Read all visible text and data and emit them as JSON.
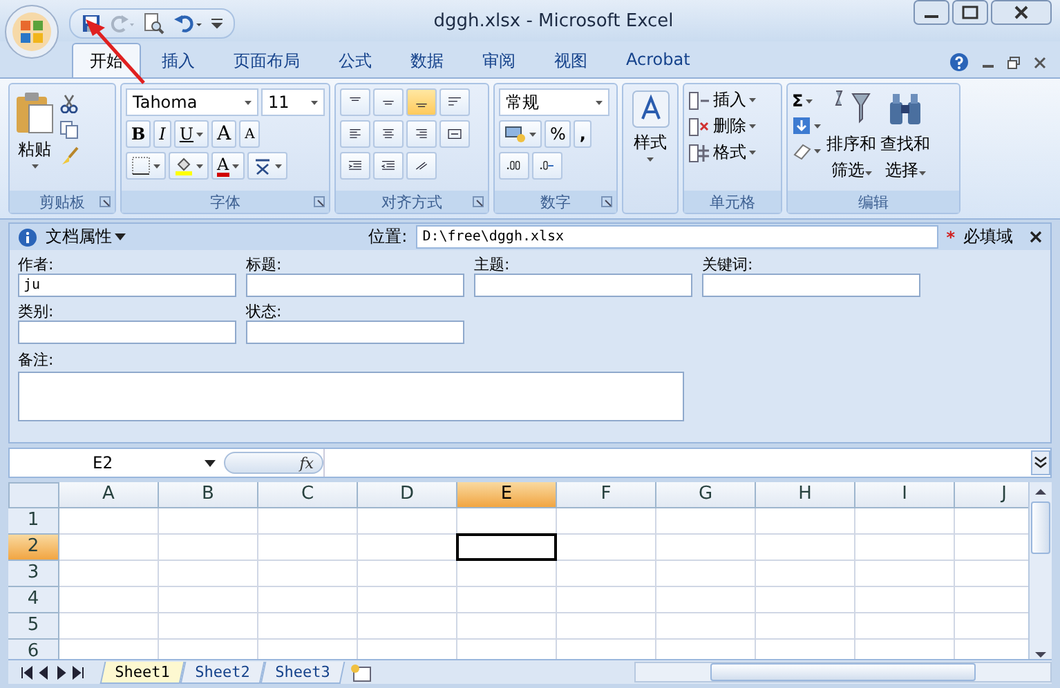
{
  "window": {
    "title": "dggh.xlsx - Microsoft Excel"
  },
  "ribbon_tabs": [
    {
      "label": "开始",
      "selected": true
    },
    {
      "label": "插入",
      "selected": false
    },
    {
      "label": "页面布局",
      "selected": false
    },
    {
      "label": "公式",
      "selected": false
    },
    {
      "label": "数据",
      "selected": false
    },
    {
      "label": "审阅",
      "selected": false
    },
    {
      "label": "视图",
      "selected": false
    },
    {
      "label": "Acrobat",
      "selected": false
    }
  ],
  "clipboard": {
    "label": "剪贴板",
    "paste": "粘贴"
  },
  "font": {
    "label": "字体",
    "font_name": "Tahoma",
    "font_size": "11",
    "bold": "B",
    "italic": "I",
    "underline": "U",
    "grow_font": "A",
    "shrink_font": "A",
    "font_color": "A"
  },
  "alignment": {
    "label": "对齐方式"
  },
  "number": {
    "label": "数字",
    "format": "常规",
    "percent": "%",
    "comma": ","
  },
  "styles": {
    "button": "样式"
  },
  "cells": {
    "label": "单元格",
    "buttons": [
      "插入",
      "删除",
      "格式"
    ]
  },
  "editing": {
    "label": "编辑",
    "sum": "Σ",
    "sort_filter": [
      "排序和",
      "筛选"
    ],
    "find_select": [
      "查找和",
      "选择"
    ]
  },
  "document_properties": {
    "title": "文档属性",
    "location_label": "位置:",
    "location": "D:\\free\\dggh.xlsx",
    "required_mark": "*",
    "required_label": "必填域",
    "fields": [
      {
        "label": "作者:",
        "value": "ju"
      },
      {
        "label": "标题:"
      },
      {
        "label": "主题:"
      },
      {
        "label": "关键词:"
      },
      {
        "label": "类别:"
      },
      {
        "label": "状态:"
      }
    ],
    "notes_label": "备注:"
  },
  "formula_bar": {
    "name_box": "E2",
    "fx": "fx"
  },
  "grid": {
    "columns": [
      {
        "label": "A",
        "selected": false
      },
      {
        "label": "B",
        "selected": false
      },
      {
        "label": "C",
        "selected": false
      },
      {
        "label": "D",
        "selected": false
      },
      {
        "label": "E",
        "selected": true
      },
      {
        "label": "F",
        "selected": false
      },
      {
        "label": "G",
        "selected": false
      },
      {
        "label": "H",
        "selected": false
      },
      {
        "label": "I",
        "selected": false
      },
      {
        "label": "J",
        "selected": false
      }
    ],
    "rows": [
      {
        "label": "1",
        "selected": false
      },
      {
        "label": "2",
        "selected": true
      },
      {
        "label": "3",
        "selected": false
      },
      {
        "label": "4",
        "selected": false
      },
      {
        "label": "5",
        "selected": false
      },
      {
        "label": "6",
        "selected": false
      }
    ]
  },
  "sheet_tabs": [
    {
      "label": "Sheet1",
      "selected": true
    },
    {
      "label": "Sheet2",
      "selected": false
    },
    {
      "label": "Sheet3",
      "selected": false
    }
  ]
}
